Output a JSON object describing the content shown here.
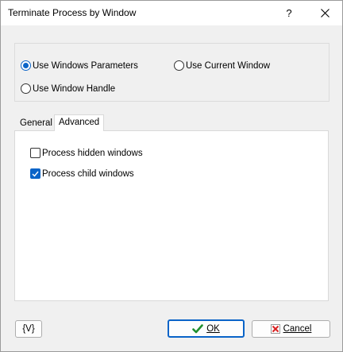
{
  "window": {
    "title": "Terminate Process by Window",
    "help_glyph": "?",
    "close_glyph": "✕"
  },
  "mode": {
    "options": [
      {
        "label": "Use Windows Parameters",
        "selected": true
      },
      {
        "label": "Use Current Window",
        "selected": false
      },
      {
        "label": "Use Window Handle",
        "selected": false
      }
    ]
  },
  "tabs": [
    {
      "label": "General",
      "active": false
    },
    {
      "label": "Advanced",
      "active": true
    }
  ],
  "advanced": {
    "options": [
      {
        "label": "Process hidden windows",
        "checked": false
      },
      {
        "label": "Process child windows",
        "checked": true
      }
    ]
  },
  "footer": {
    "variables_label": "{V}",
    "ok_label": "OK",
    "cancel_label": "Cancel"
  },
  "colors": {
    "accent": "#0a64c8",
    "ok_icon": "#1f8f2e",
    "cancel_icon": "#d92020"
  }
}
